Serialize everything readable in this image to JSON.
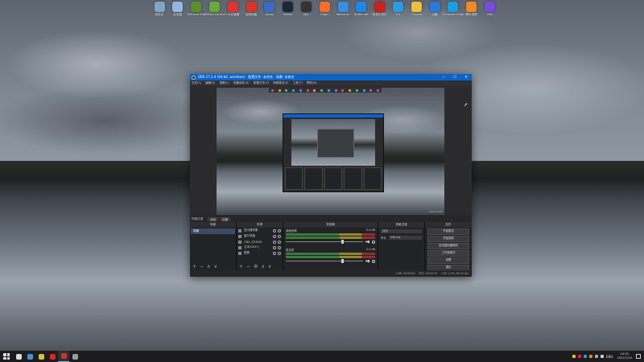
{
  "desktop": {
    "icons": [
      {
        "label": "回收站",
        "color": "#7fa6c8",
        "icon": "recycle-bin-icon"
      },
      {
        "label": "此电脑",
        "color": "#8fb8e0",
        "icon": "computer-icon"
      },
      {
        "label": "GeForce Exp",
        "color": "#5b8f2e",
        "icon": "geforce-icon"
      },
      {
        "label": "NVIDIA Control",
        "color": "#6aa83a",
        "icon": "nvidia-icon"
      },
      {
        "label": "UU加速器",
        "color": "#e03434",
        "icon": "uu-icon"
      },
      {
        "label": "百度网盘",
        "color": "#d9342b",
        "icon": "baidu-icon"
      },
      {
        "label": "Uplay",
        "color": "#3a6bc9",
        "icon": "uplay-icon"
      },
      {
        "label": "Steam",
        "color": "#1b2838",
        "icon": "steam-icon"
      },
      {
        "label": "Epic",
        "color": "#333333",
        "icon": "epic-icon"
      },
      {
        "label": "Origin",
        "color": "#f56c2d",
        "icon": "origin-icon"
      },
      {
        "label": "WeGame",
        "color": "#3b8de0",
        "icon": "wegame-icon"
      },
      {
        "label": "Battle.net",
        "color": "#1d88e5",
        "icon": "battlenet-icon"
      },
      {
        "label": "网易云音乐",
        "color": "#c8231e",
        "icon": "music-icon"
      },
      {
        "label": "QQ",
        "color": "#2c9be0",
        "icon": "qq-icon"
      },
      {
        "label": "Chrome",
        "color": "#e8c23a",
        "icon": "chrome-icon"
      },
      {
        "label": "迅雷",
        "color": "#2a7ad9",
        "icon": "xunlei-icon"
      },
      {
        "label": "Microsoft Edge",
        "color": "#1f9de0",
        "icon": "edge-icon"
      },
      {
        "label": "腾讯视频",
        "color": "#f08a24",
        "icon": "video-icon"
      },
      {
        "label": "OBS",
        "color": "#7a4ad9",
        "icon": "obs-icon"
      }
    ]
  },
  "obs": {
    "title": "OBS 27.2.4 (64-bit, windows) - 配置文件: 未命名 - 场景: 未命名",
    "window_controls": [
      "─",
      "☐",
      "✕"
    ],
    "menu": [
      "文件(F)",
      "编辑(E)",
      "视图(V)",
      "停靠部件(D)",
      "配置文件(P)",
      "场景集合(S)",
      "工具(T)",
      "帮助(H)"
    ],
    "preview_status": "1920x1080",
    "dock_tabs": {
      "label": "场景过渡",
      "buttons": [
        "淡出",
        "过渡"
      ]
    },
    "scenes": {
      "header": "场景",
      "items": [
        "场景"
      ],
      "footer": [
        "+",
        "−",
        "∧",
        "∨"
      ]
    },
    "sources": {
      "header": "来源",
      "items": [
        "显示器采集",
        "窗口采集",
        "OBS_STUDIO",
        "文本(GDI+)",
        "图像"
      ],
      "footer": [
        "+",
        "−",
        "⚙",
        "∧",
        "∨"
      ]
    },
    "mixer": {
      "header": "混音器",
      "channels": [
        {
          "name": "桌面音频",
          "db": "0.0 dB",
          "level": 0.72
        },
        {
          "name": "麦克风",
          "db": "0.0 dB",
          "level": 0.72
        }
      ]
    },
    "transitions": {
      "header": "场景过渡",
      "type": "淡出",
      "duration_label": "时长",
      "duration": "300 ms"
    },
    "controls": {
      "header": "控件",
      "buttons": [
        "开始推流",
        "开始录制",
        "启动虚拟摄像机",
        "工作室模式",
        "设置",
        "退出"
      ]
    },
    "statusbar": [
      "LIVE: 00:00:00",
      "REC: 00:00:00",
      "CPU: 2.3%, 60.00 fps"
    ]
  },
  "taskbar": {
    "apps": [
      {
        "name": "search",
        "color": "#dddddd",
        "icon": "search-icon",
        "active": false
      },
      {
        "name": "steam",
        "color": "#4a8fd6",
        "icon": "steam-icon",
        "active": false
      },
      {
        "name": "chrome",
        "color": "#d9c23a",
        "icon": "chrome-icon",
        "active": false
      },
      {
        "name": "netease",
        "color": "#d92a2a",
        "icon": "music-icon",
        "active": false
      },
      {
        "name": "obs",
        "color": "#c0392b",
        "icon": "obs-icon",
        "active": true
      },
      {
        "name": "download",
        "color": "#9a9a9a",
        "icon": "download-icon",
        "active": false
      }
    ],
    "tray_lang": "ENG",
    "time": "14:20",
    "date": "2022/7/10"
  }
}
